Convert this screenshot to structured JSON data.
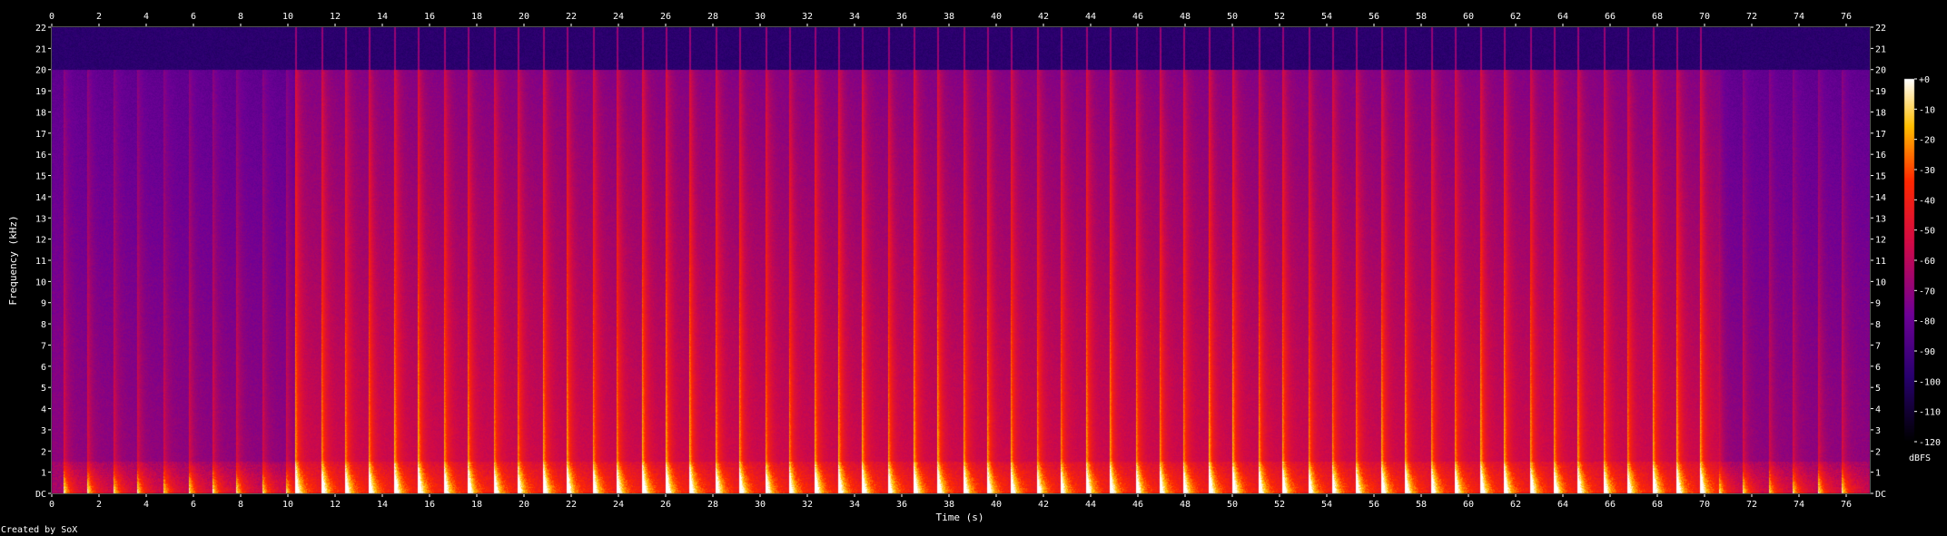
{
  "chart_data": {
    "type": "heatmap",
    "title": "",
    "xlabel": "Time (s)",
    "ylabel": "Frequency (kHz)",
    "xlim": [
      0,
      77
    ],
    "ylim": [
      0,
      22
    ],
    "x_ticks": [
      "0",
      "2",
      "4",
      "6",
      "8",
      "10",
      "12",
      "14",
      "16",
      "18",
      "20",
      "22",
      "24",
      "26",
      "28",
      "30",
      "32",
      "34",
      "36",
      "38",
      "40",
      "42",
      "44",
      "46",
      "48",
      "50",
      "52",
      "54",
      "56",
      "58",
      "60",
      "62",
      "64",
      "66",
      "68",
      "70",
      "72",
      "74",
      "76"
    ],
    "y_ticks": [
      "DC",
      "1",
      "2",
      "3",
      "4",
      "5",
      "6",
      "7",
      "8",
      "9",
      "10",
      "11",
      "12",
      "13",
      "14",
      "15",
      "16",
      "17",
      "18",
      "19",
      "20",
      "21",
      "22"
    ],
    "colorbar": {
      "label": "dBFS",
      "ticks": [
        "+0",
        "-10",
        "-20",
        "-30",
        "-40",
        "-50",
        "-60",
        "-70",
        "-80",
        "-90",
        "-100",
        "-110",
        "-120"
      ],
      "range": [
        -120,
        0
      ]
    },
    "grid": false,
    "bandlimit_khz": 20,
    "bright_section": [
      10.3,
      70.6
    ],
    "onsets_s": [
      0.5,
      1.5,
      2.6,
      3.6,
      4.7,
      5.8,
      6.8,
      7.8,
      8.9,
      9.9,
      10.3,
      11.4,
      12.4,
      13.4,
      14.5,
      15.5,
      16.6,
      17.6,
      18.7,
      19.7,
      20.8,
      21.8,
      22.9,
      23.9,
      25.0,
      26.0,
      27.0,
      28.1,
      29.1,
      30.2,
      31.2,
      32.3,
      33.3,
      34.3,
      35.4,
      36.5,
      37.5,
      38.6,
      39.6,
      40.6,
      41.7,
      42.7,
      43.8,
      44.8,
      45.9,
      46.9,
      47.9,
      49.0,
      50.0,
      51.1,
      52.1,
      53.2,
      54.2,
      55.2,
      56.3,
      57.3,
      58.4,
      59.4,
      60.5,
      61.5,
      62.6,
      63.6,
      64.6,
      65.7,
      66.7,
      67.8,
      68.8,
      69.8,
      70.6,
      71.6,
      72.7,
      73.7,
      74.8,
      75.8
    ]
  },
  "footer": {
    "credit": "Created by SoX"
  },
  "colors": {
    "background": "#000000",
    "text": "#ffffff",
    "tick": "#ffffff"
  }
}
